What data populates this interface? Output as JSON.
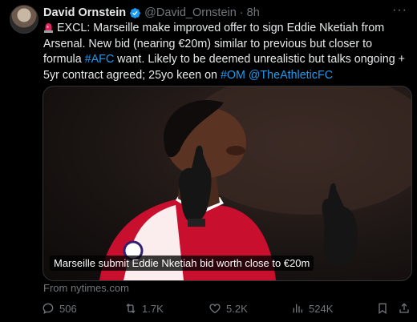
{
  "tweet": {
    "author_name": "David Ornstein",
    "handle": "@David_Ornstein",
    "separator": "·",
    "time": "8h",
    "more_label": "···",
    "text_part1": "EXCL: Marseille make improved offer to sign Eddie Nketiah from Arsenal. New bid (nearing €20m) similar to previous but closer to formula ",
    "hashtag_afc": "#AFC",
    "text_part2": " want. Likely to be deemed unrealistic but talks ongoing + 5yr contract agreed; 25yo keen on ",
    "hashtag_om": "#OM",
    "text_space": " ",
    "mention_athletic": "@TheAthleticFC",
    "media_caption": "Marseille submit Eddie Nketiah bid worth close to €20m",
    "from_source": "From nytimes.com"
  },
  "actions": {
    "replies": "506",
    "retweets": "1.7K",
    "likes": "5.2K",
    "views": "524K"
  },
  "colors": {
    "background": "#000000",
    "text": "#e7e9ea",
    "secondary": "#71767b",
    "link": "#1d9bf0",
    "verified": "#1d9bf0",
    "siren": "#e0245e"
  },
  "icons": {
    "verified": "verified-badge-icon",
    "siren": "siren-emoji-icon",
    "reply": "reply-icon",
    "retweet": "retweet-icon",
    "like": "heart-icon",
    "views": "views-icon",
    "bookmark": "bookmark-icon",
    "share": "share-icon"
  }
}
